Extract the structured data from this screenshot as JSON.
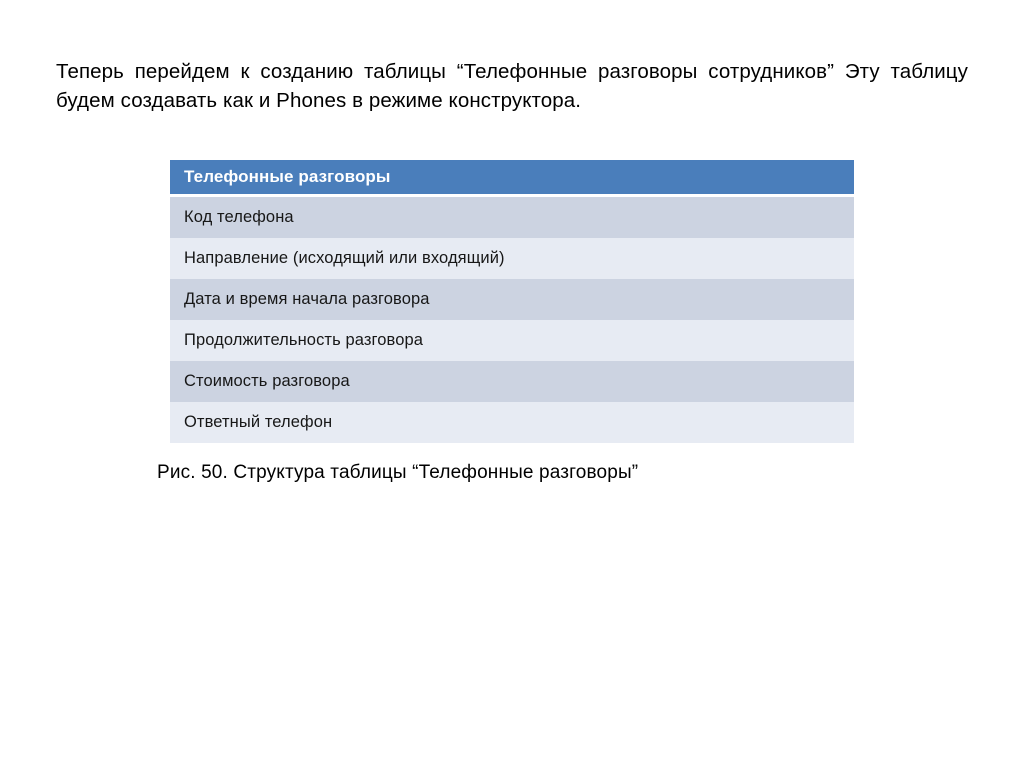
{
  "slide": {
    "intro_paragraph": "Теперь перейдем к созданию таблицы “Телефонные разговоры сотрудников” Эту таблицу будем создавать как и Phones в режиме конструктора.",
    "caption": "Рис. 50. Структура таблицы  “Телефонные разговоры”"
  },
  "table": {
    "header": "Телефонные разговоры",
    "rows": [
      {
        "label": "Код телефона"
      },
      {
        "label": "Направление (исходящий или входящий)"
      },
      {
        "label": "Дата и время начала разговора"
      },
      {
        "label": "Продолжительность разговора"
      },
      {
        "label": "Стоимость разговора"
      },
      {
        "label": "Ответный телефон"
      }
    ]
  },
  "colors": {
    "header_blue": "#4a7ebb",
    "row_dark": "#ccd3e1",
    "row_light": "#e7ebf3",
    "header_text": "#ffffff",
    "body_text": "#000000",
    "background": "#ffffff"
  }
}
